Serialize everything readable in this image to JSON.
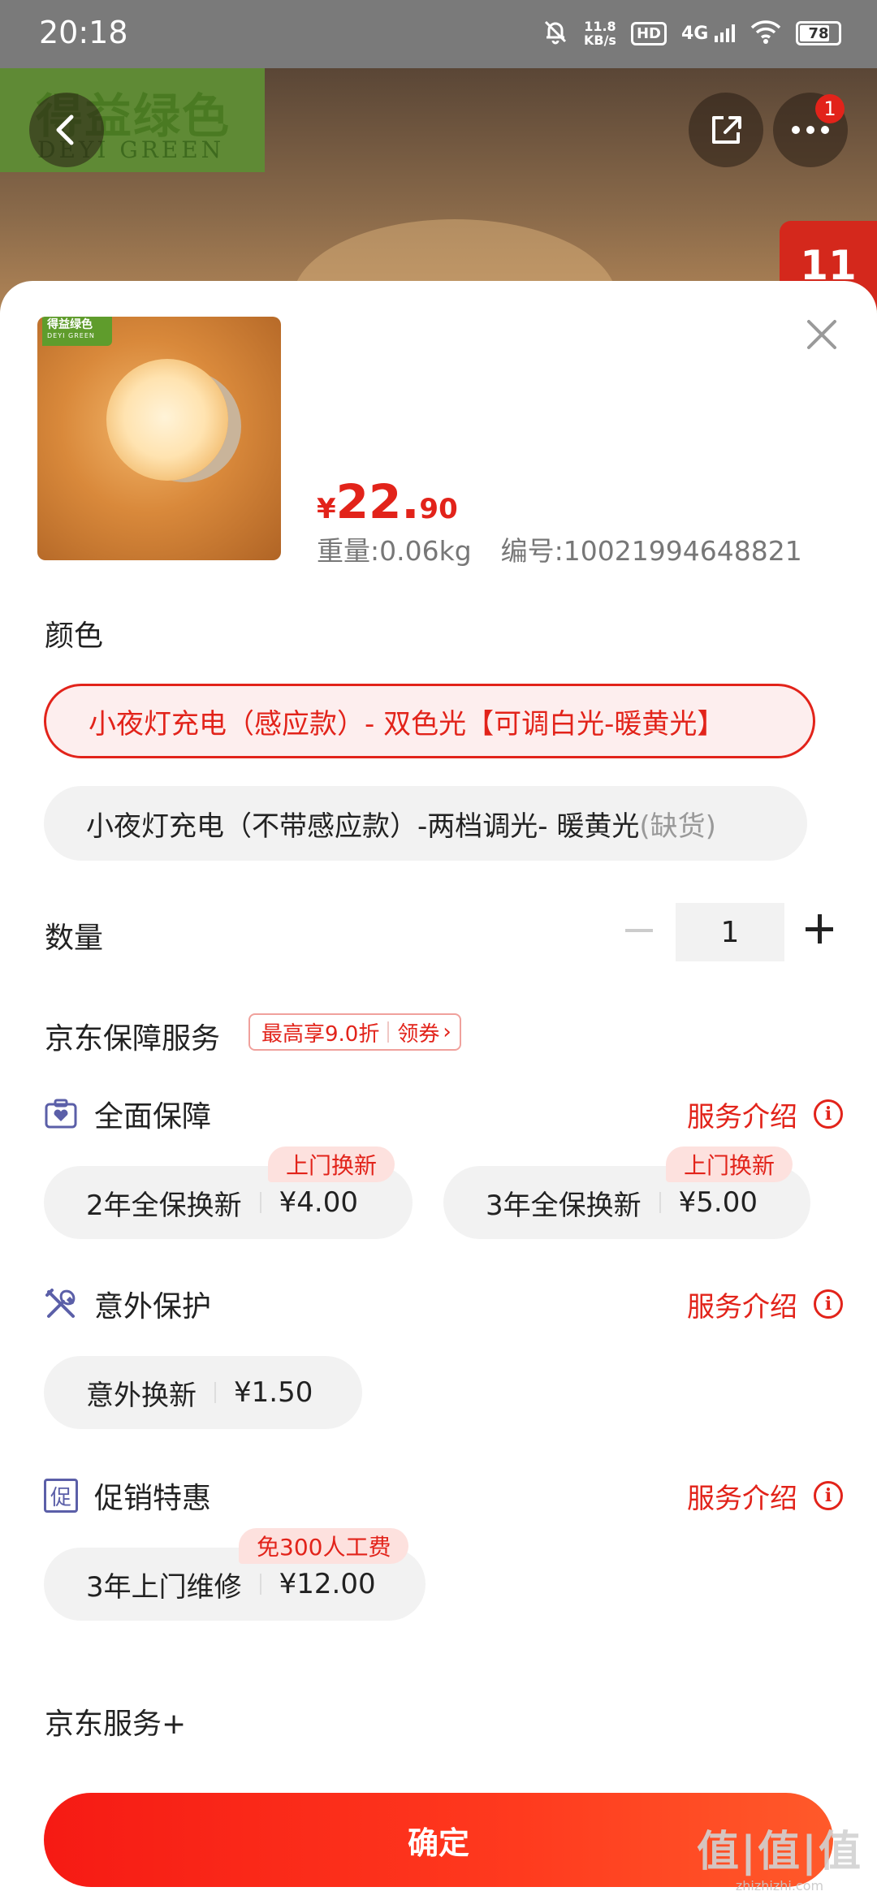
{
  "status_bar": {
    "time": "20:18",
    "net_speed_value": "11.8",
    "net_speed_unit": "KB/s",
    "hd_label": "HD",
    "network_label": "4G",
    "battery_level": "78"
  },
  "background": {
    "brand_cn": "得益绿色",
    "brand_en": "DEYI GREEN",
    "more_badge_count": "1"
  },
  "product": {
    "thumb_brand_cn": "得益绿色",
    "thumb_brand_en": "DEYI GREEN",
    "currency": "¥",
    "price_int": "22.",
    "price_dec": "90",
    "weight": "重量:0.06kg",
    "sku": "编号:10021994648821"
  },
  "color_section": {
    "title": "颜色",
    "options": [
      {
        "label": "小夜灯充电（感应款）- 双色光【可调白光-暖黄光】",
        "suffix": ""
      },
      {
        "label": "小夜灯充电（不带感应款）-两档调光- 暖黄光",
        "suffix": "(缺货)"
      }
    ]
  },
  "quantity": {
    "title": "数量",
    "value": "1"
  },
  "jd_protection": {
    "title": "京东保障服务",
    "coupon_text": "最高享9.0折",
    "coupon_action": "领券",
    "coupon_arrow": "›",
    "groups": [
      {
        "name": "全面保障",
        "link": "服务介绍",
        "icon": "shield-heart-icon",
        "options": [
          {
            "name": "2年全保换新",
            "price": "¥4.00",
            "tag": "上门换新"
          },
          {
            "name": "3年全保换新",
            "price": "¥5.00",
            "tag": "上门换新"
          }
        ]
      },
      {
        "name": "意外保护",
        "link": "服务介绍",
        "icon": "tools-icon",
        "options": [
          {
            "name": "意外换新",
            "price": "¥1.50",
            "tag": ""
          }
        ]
      },
      {
        "name": "促销特惠",
        "link": "服务介绍",
        "icon": "promo-icon",
        "icon_text": "促",
        "options": [
          {
            "name": "3年上门维修",
            "price": "¥12.00",
            "tag": "免300人工费"
          }
        ]
      }
    ]
  },
  "jd_service_plus": {
    "title": "京东服务+"
  },
  "confirm_label": "确定",
  "watermark": {
    "main": "值|值|值",
    "sub": "zhizhizhi.com"
  },
  "colors": {
    "accent": "#e2231a",
    "selected_bg": "#fdeeee",
    "chip_bg": "#f2f2f2",
    "tag_bg": "#fde1de"
  }
}
